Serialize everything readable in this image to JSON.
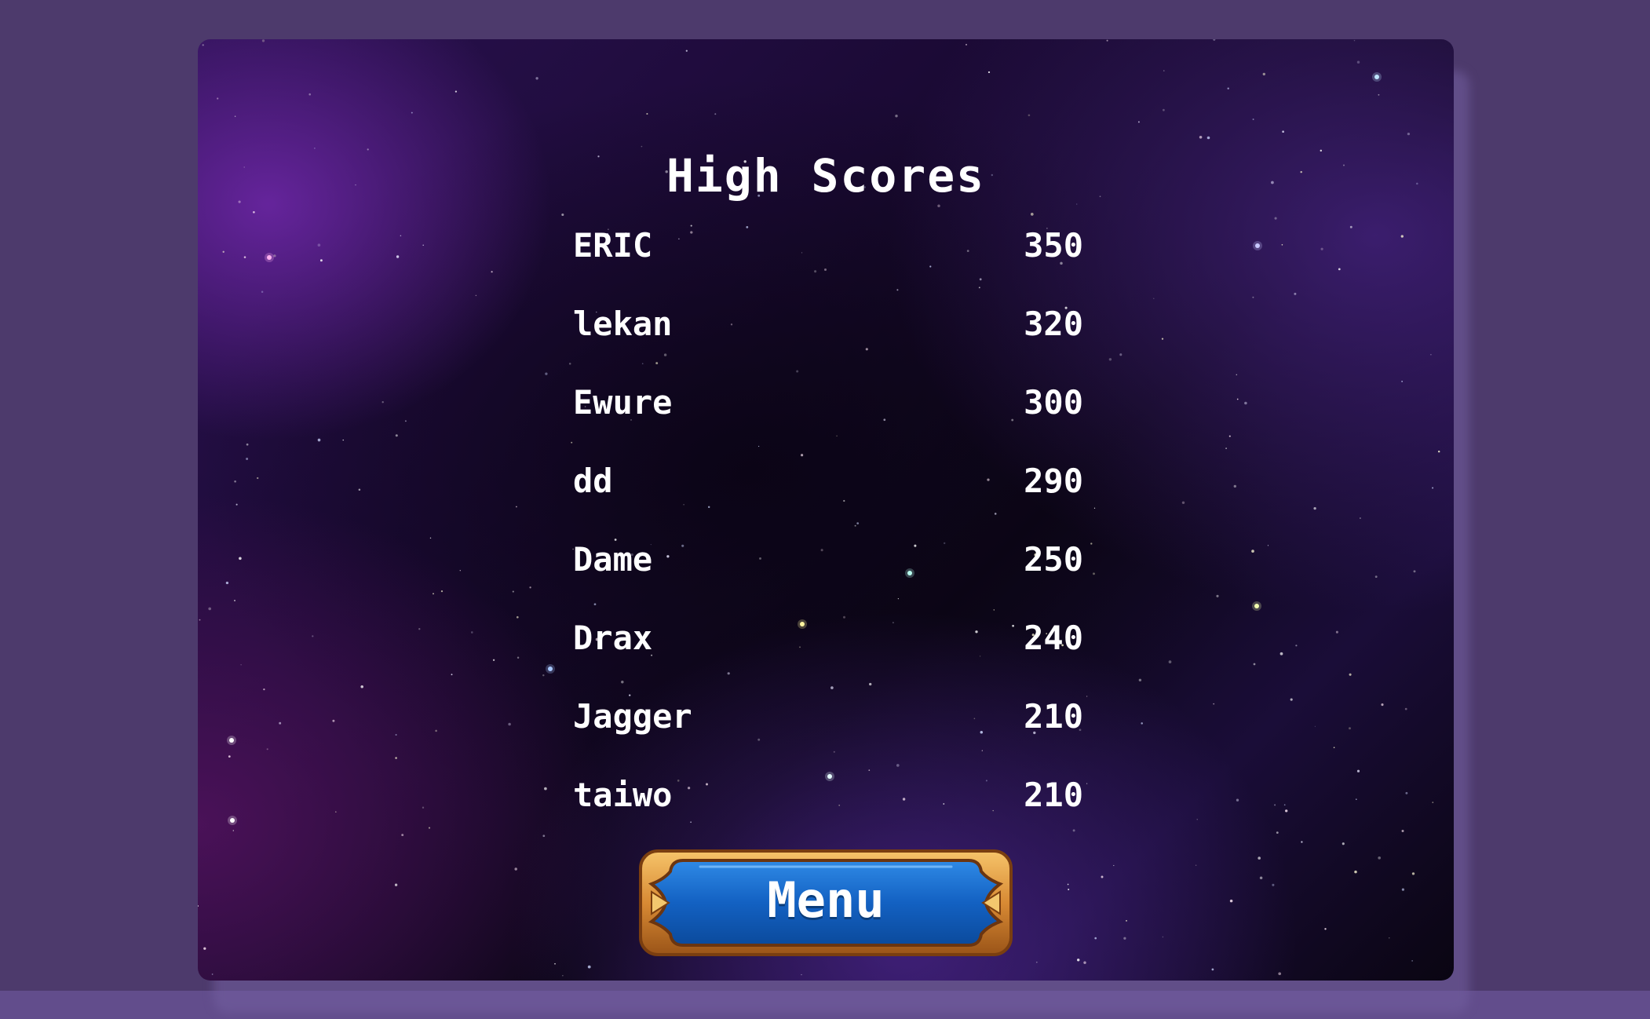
{
  "screen": {
    "title": "High Scores"
  },
  "scores": [
    {
      "name": "ERIC",
      "score": "350"
    },
    {
      "name": "lekan",
      "score": "320"
    },
    {
      "name": "Ewure",
      "score": "300"
    },
    {
      "name": "dd",
      "score": "290"
    },
    {
      "name": "Dame",
      "score": "250"
    },
    {
      "name": "Drax",
      "score": "240"
    },
    {
      "name": "Jagger",
      "score": "210"
    },
    {
      "name": "taiwo",
      "score": "210"
    }
  ],
  "menu_button": {
    "label": "Menu"
  },
  "colors": {
    "page_background": "#4d3a6c",
    "text": "#ffffff",
    "button_blue": "#1565c0",
    "button_frame_gold": "#e0943a"
  }
}
